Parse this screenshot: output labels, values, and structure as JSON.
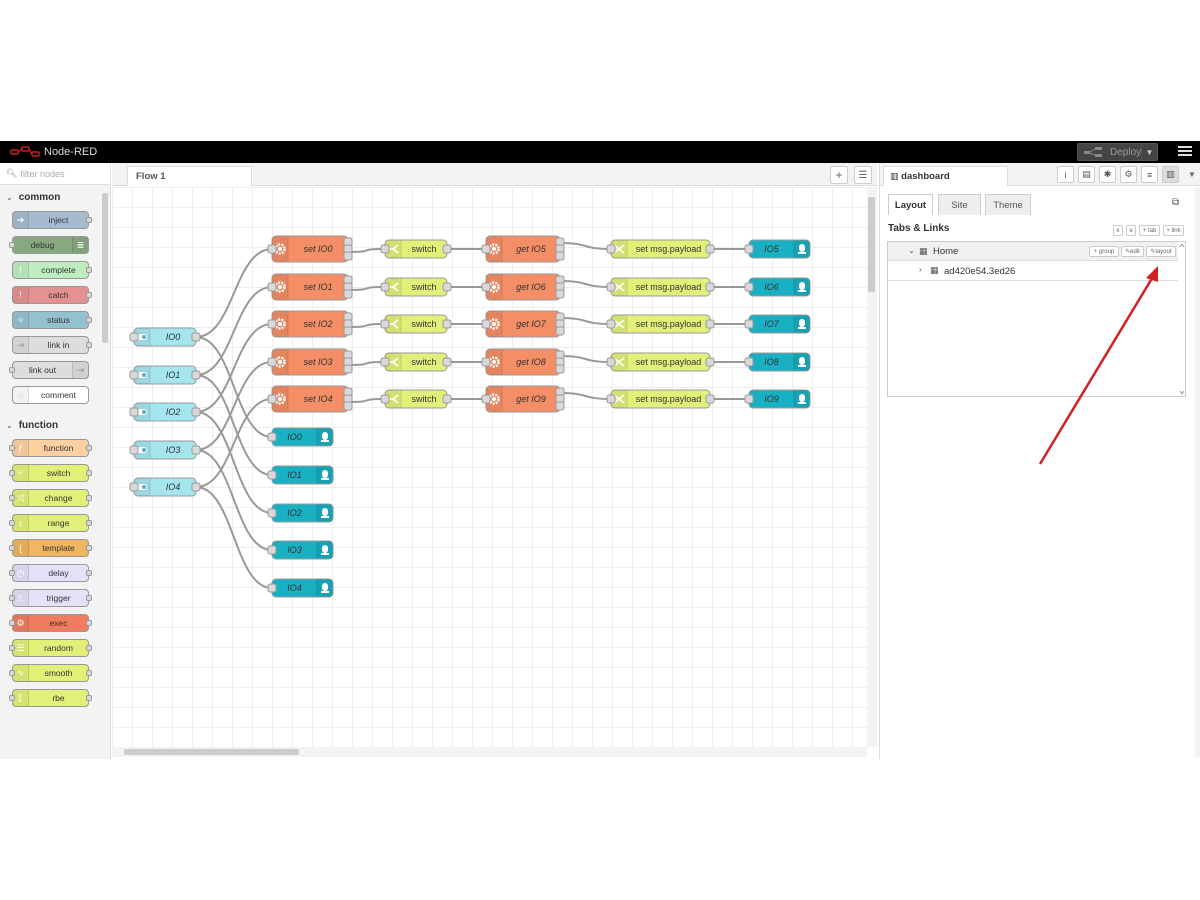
{
  "header": {
    "app_title": "Node-RED",
    "deploy_label": "Deploy"
  },
  "palette": {
    "search_placeholder": "filter nodes",
    "categories": [
      {
        "name": "common",
        "nodes": [
          {
            "label": "inject",
            "color": "#a6bbcf",
            "icon": "arrow-right-icon"
          },
          {
            "label": "debug",
            "color": "#87a980",
            "icon": "list-icon"
          },
          {
            "label": "complete",
            "color": "#c0edc0",
            "icon": "exclamation-icon"
          },
          {
            "label": "catch",
            "color": "#e49191",
            "icon": "exclamation-icon"
          },
          {
            "label": "status",
            "color": "#94c1d0",
            "icon": "pulse-icon"
          },
          {
            "label": "link in",
            "color": "#dddddd",
            "icon": "link-in-icon"
          },
          {
            "label": "link out",
            "color": "#dddddd",
            "icon": "link-out-icon"
          },
          {
            "label": "comment",
            "color": "#ffffff",
            "icon": "comment-icon"
          }
        ]
      },
      {
        "name": "function",
        "nodes": [
          {
            "label": "function",
            "color": "#fdd0a2",
            "icon": "function-icon"
          },
          {
            "label": "switch",
            "color": "#e2f07a",
            "icon": "switch-icon"
          },
          {
            "label": "change",
            "color": "#e2f07a",
            "icon": "shuffle-icon"
          },
          {
            "label": "range",
            "color": "#e2f07a",
            "icon": "range-icon"
          },
          {
            "label": "template",
            "color": "#f0b660",
            "icon": "template-icon"
          },
          {
            "label": "delay",
            "color": "#e6e0f8",
            "icon": "timer-icon"
          },
          {
            "label": "trigger",
            "color": "#e6e0f8",
            "icon": "trigger-icon"
          },
          {
            "label": "exec",
            "color": "#f27c5f",
            "icon": "cog-icon"
          },
          {
            "label": "random",
            "color": "#e2f07a",
            "icon": "random-icon"
          },
          {
            "label": "smooth",
            "color": "#e2f07a",
            "icon": "wave-icon"
          },
          {
            "label": "rbe",
            "color": "#e2f07a",
            "icon": "rbe-icon"
          }
        ]
      }
    ]
  },
  "workspace": {
    "tabs": [
      {
        "label": "Flow 1"
      }
    ]
  },
  "flow": {
    "inputs": [
      "IO0",
      "IO1",
      "IO2",
      "IO3",
      "IO4"
    ],
    "set_nodes": [
      "set IO0",
      "set IO1",
      "set IO2",
      "set IO3",
      "set IO4"
    ],
    "switch_nodes": [
      "switch",
      "switch",
      "switch",
      "switch",
      "switch"
    ],
    "get_nodes": [
      "get IO5",
      "get IO6",
      "get IO7",
      "get IO8",
      "get IO9"
    ],
    "change_nodes": [
      "set msg.payload",
      "set msg.payload",
      "set msg.payload",
      "set msg.payload",
      "set msg.payload"
    ],
    "out_nodes": [
      "IO5",
      "IO6",
      "IO7",
      "IO8",
      "IO9"
    ],
    "led_nodes": [
      "IO0",
      "IO1",
      "IO2",
      "IO3",
      "IO4"
    ],
    "colors": {
      "input": "#a4e5f0",
      "set": "#f38e67",
      "switch": "#e2f07a",
      "get": "#f38e67",
      "change": "#e2f07a",
      "led": "#1ab0c4"
    }
  },
  "sidebar": {
    "tab_label": "dashboard",
    "dash_tabs": [
      "Layout",
      "Site",
      "Theme"
    ],
    "section_title": "Tabs & Links",
    "mini_buttons": [
      "+ tab",
      "+ link"
    ],
    "tree": {
      "tab_name": "Home",
      "tab_buttons": [
        "+ group",
        "edit",
        "layout"
      ],
      "group_name": "ad420e54.3ed26"
    }
  },
  "annotation": {
    "color": "#d42020"
  }
}
